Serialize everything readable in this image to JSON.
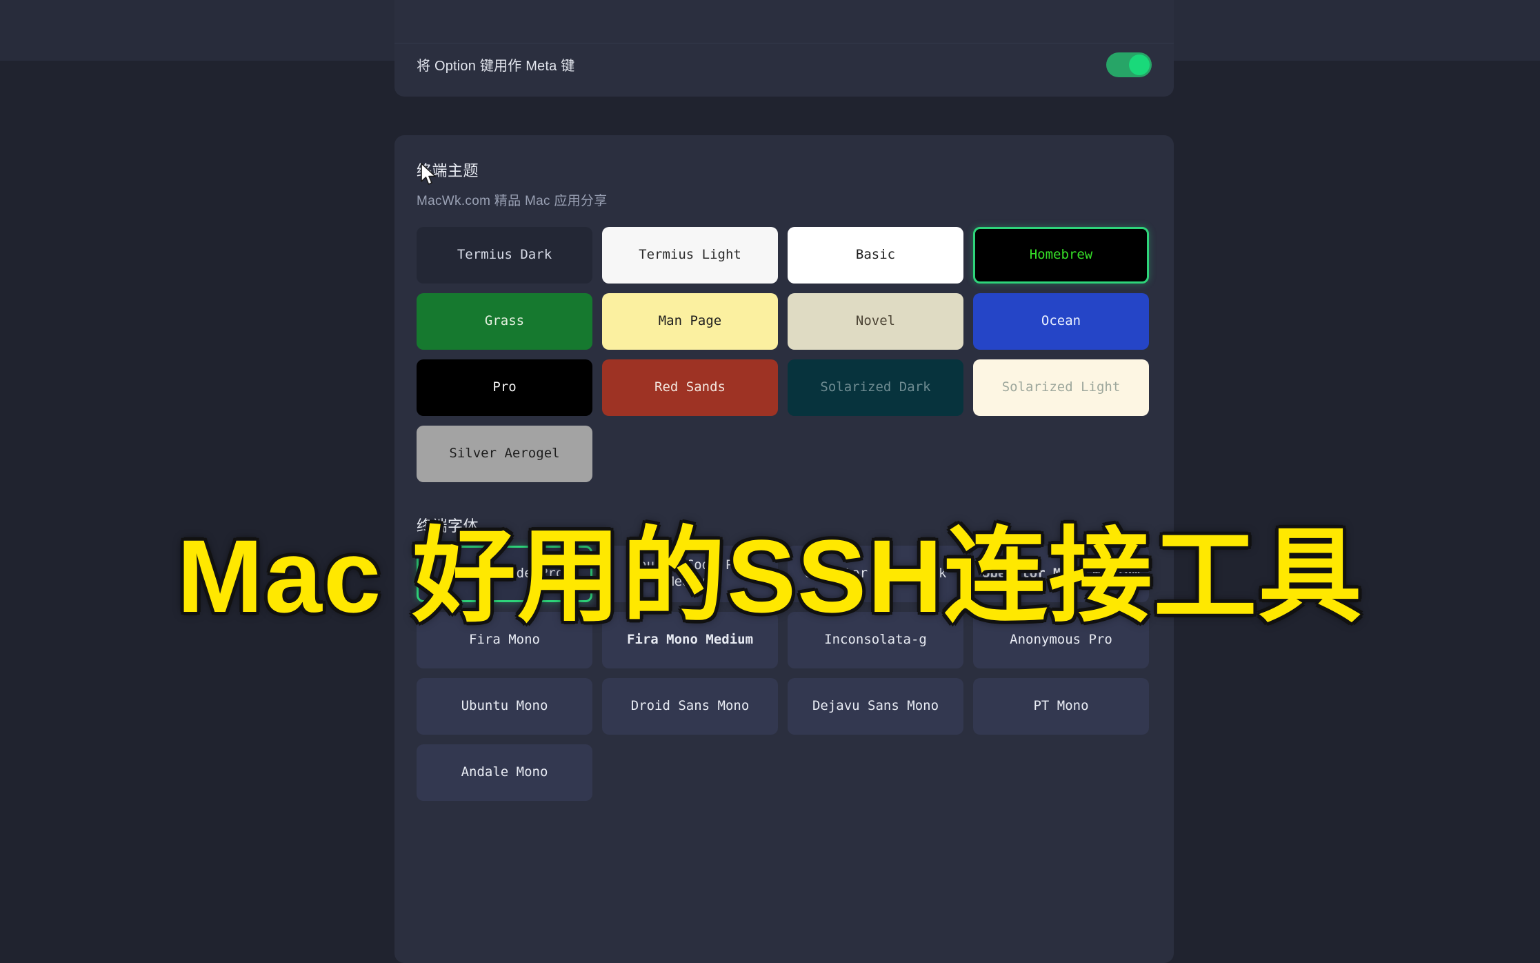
{
  "meta_row": {
    "label": "将 Option 键用作 Meta 键",
    "toggle_state": "on",
    "toggle_color": "#19d97a"
  },
  "theme_section": {
    "title": "终端主题",
    "subtitle": "MacWk.com 精品 Mac 应用分享",
    "selected": "Homebrew",
    "themes": [
      {
        "label": "Termius Dark",
        "bg": "#232735",
        "fg": "#d8dce8"
      },
      {
        "label": "Termius Light",
        "bg": "#f7f7f7",
        "fg": "#2a2a2a"
      },
      {
        "label": "Basic",
        "bg": "#ffffff",
        "fg": "#1c1c1c"
      },
      {
        "label": "Homebrew",
        "bg": "#000000",
        "fg": "#36e028"
      },
      {
        "label": "Grass",
        "bg": "#16792f",
        "fg": "#e4f0df"
      },
      {
        "label": "Man Page",
        "bg": "#fbf0a0",
        "fg": "#1d1d1d"
      },
      {
        "label": "Novel",
        "bg": "#dfdbc3",
        "fg": "#4b4334"
      },
      {
        "label": "Ocean",
        "bg": "#2545c7",
        "fg": "#eaf0ff"
      },
      {
        "label": "Pro",
        "bg": "#000000",
        "fg": "#f2f2f2"
      },
      {
        "label": "Red Sands",
        "bg": "#9e3324",
        "fg": "#f4e7df"
      },
      {
        "label": "Solarized Dark",
        "bg": "#07333d",
        "fg": "#6f8c92"
      },
      {
        "label": "Solarized Light",
        "bg": "#fdf6e3",
        "fg": "#9da79c"
      },
      {
        "label": "Silver Aerogel",
        "bg": "#a3a3a3",
        "fg": "#1e1e1e"
      }
    ]
  },
  "font_section": {
    "title": "终端字体",
    "selected": "Source Code Pro",
    "fonts": [
      {
        "label": "Source Code Pro",
        "weight": "normal"
      },
      {
        "label": "Source Code Pro Medium",
        "weight": "normal"
      },
      {
        "label": "Operator Mono Book",
        "weight": "normal"
      },
      {
        "label": "Operator Mono Medium",
        "weight": "bold"
      },
      {
        "label": "Fira Mono",
        "weight": "normal"
      },
      {
        "label": "Fira Mono Medium",
        "weight": "bold"
      },
      {
        "label": "Inconsolata-g",
        "weight": "normal"
      },
      {
        "label": "Anonymous Pro",
        "weight": "normal"
      },
      {
        "label": "Ubuntu Mono",
        "weight": "normal"
      },
      {
        "label": "Droid Sans Mono",
        "weight": "normal"
      },
      {
        "label": "Dejavu Sans Mono",
        "weight": "normal"
      },
      {
        "label": "PT Mono",
        "weight": "normal"
      },
      {
        "label": "Andale Mono",
        "weight": "normal"
      }
    ]
  },
  "overlay": {
    "caption": "Mac 好用的SSH连接工具",
    "caption_color": "#ffe800"
  }
}
